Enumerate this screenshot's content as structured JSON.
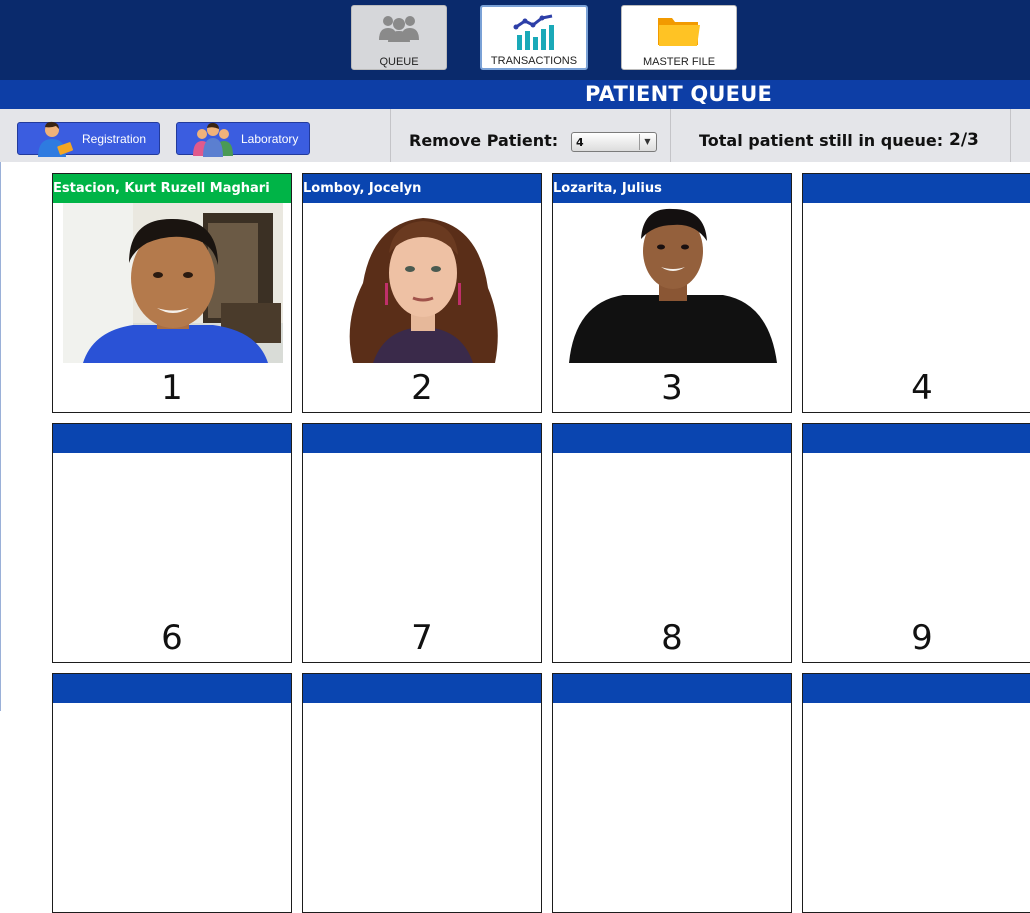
{
  "nav": {
    "queue_label": "QUEUE",
    "transactions_label": "TRANSACTIONS",
    "master_file_label": "MASTER FILE"
  },
  "page_title": "PATIENT QUEUE",
  "toolbar": {
    "registration_label": "Registration",
    "laboratory_label": "Laboratory",
    "remove_patient_label": "Remove Patient:",
    "remove_patient_value": "4",
    "queue_status_label": "Total patient still in queue:",
    "queue_status_value": "2/3"
  },
  "queue": [
    {
      "name": "Estacion, Kurt Ruzell Maghari",
      "number": "1",
      "active": true,
      "photo": "young man, blue shirt, webcam"
    },
    {
      "name": "Lomboy, Jocelyn",
      "number": "2",
      "active": false,
      "photo": "woman, curly red hair"
    },
    {
      "name": "Lozarita, Julius",
      "number": "3",
      "active": false,
      "photo": "young man, black shirt"
    },
    {
      "name": "",
      "number": "4",
      "active": false
    },
    {
      "name": "",
      "number": "6",
      "active": false
    },
    {
      "name": "",
      "number": "7",
      "active": false
    },
    {
      "name": "",
      "number": "8",
      "active": false
    },
    {
      "name": "",
      "number": "9",
      "active": false
    },
    {
      "name": "",
      "number": "",
      "active": false
    },
    {
      "name": "",
      "number": "",
      "active": false
    },
    {
      "name": "",
      "number": "",
      "active": false
    },
    {
      "name": "",
      "number": "",
      "active": false
    }
  ],
  "colors": {
    "topbar": "#0a2a6c",
    "title_bar": "#0d3ea6",
    "card_header": "#0a45b0",
    "card_header_active": "#00b447",
    "button": "#3b5de0"
  }
}
